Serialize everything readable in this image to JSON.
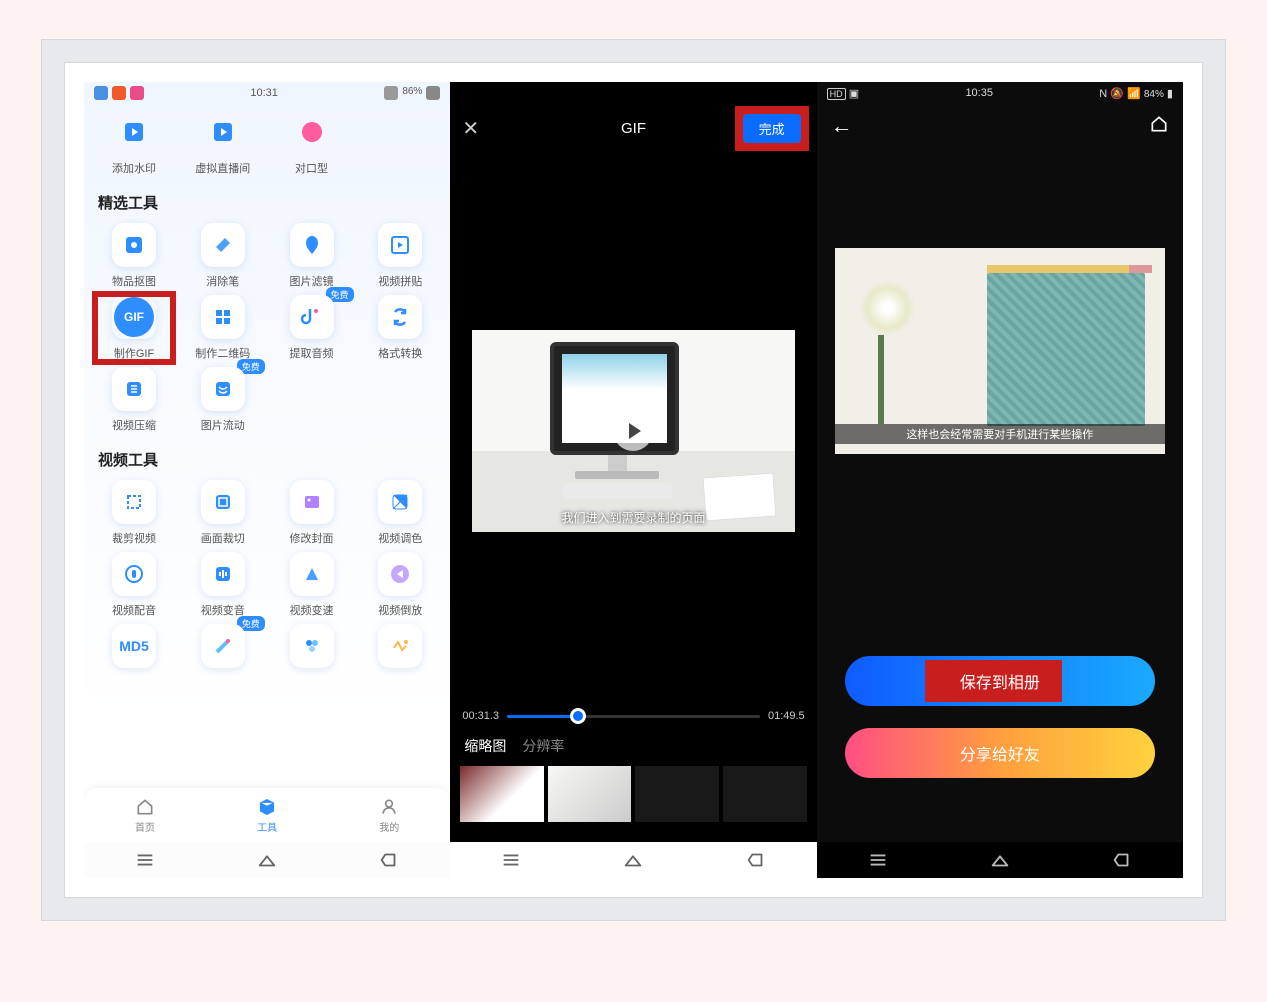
{
  "screen1": {
    "status_time": "10:31",
    "status_right": "86%",
    "top_row": [
      {
        "label": "添加水印"
      },
      {
        "label": "虚拟直播间"
      },
      {
        "label": "对口型"
      }
    ],
    "section1_title": "精选工具",
    "tools1": [
      {
        "label": "物品抠图"
      },
      {
        "label": "消除笔"
      },
      {
        "label": "图片滤镜"
      },
      {
        "label": "视频拼贴"
      },
      {
        "label": "制作GIF",
        "highlight": true,
        "gif": true
      },
      {
        "label": "制作二维码"
      },
      {
        "label": "提取音频",
        "badge": "免费"
      },
      {
        "label": "格式转换"
      },
      {
        "label": "视频压缩"
      },
      {
        "label": "图片流动",
        "badge": "免费"
      }
    ],
    "section2_title": "视频工具",
    "tools2": [
      {
        "label": "裁剪视频"
      },
      {
        "label": "画面裁切"
      },
      {
        "label": "修改封面"
      },
      {
        "label": "视频调色"
      },
      {
        "label": "视频配音"
      },
      {
        "label": "视频变音"
      },
      {
        "label": "视频变速"
      },
      {
        "label": "视频倒放"
      },
      {
        "label": "MD5",
        "label_text": "MD5"
      },
      {
        "label": "",
        "badge": "免费"
      },
      {
        "label": ""
      },
      {
        "label": ""
      }
    ],
    "nav": {
      "home": "首页",
      "tools": "工具",
      "mine": "我的"
    }
  },
  "screen2": {
    "title": "GIF",
    "done": "完成",
    "caption": "我们进入到需要录制的页面",
    "time_start": "00:31.3",
    "time_end": "01:49.5",
    "tab1": "缩略图",
    "tab2": "分辨率"
  },
  "screen3": {
    "status_time": "10:35",
    "status_right": "84%",
    "caption": "这样也会经常需要对手机进行某些操作",
    "save": "保存到相册",
    "share": "分享给好友"
  }
}
